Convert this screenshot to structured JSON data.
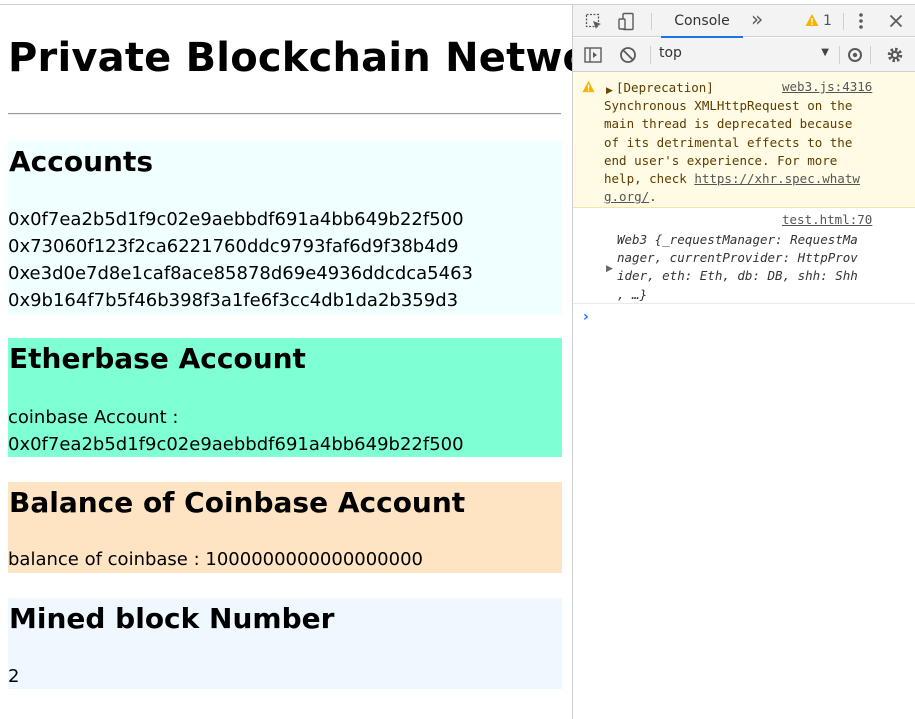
{
  "page": {
    "title": "Private Blockchain Network",
    "accounts": {
      "heading": "Accounts",
      "list": [
        "0x0f7ea2b5d1f9c02e9aebbdf691a4bb649b22f500",
        "0x73060f123f2ca6221760ddc9793faf6d9f38b4d9",
        "0xe3d0e7d8e1caf8ace85878d69e4936ddcdca5463",
        "0x9b164f7b5f46b398f3a1fe6f3cc4db1da2b359d3"
      ]
    },
    "etherbase": {
      "heading": "Etherbase Account",
      "label": "coinbase Account :",
      "value": "0x0f7ea2b5d1f9c02e9aebbdf691a4bb649b22f500"
    },
    "balance": {
      "heading": "Balance of Coinbase Account",
      "text": "balance of coinbase : 1000000000000000000"
    },
    "mined": {
      "heading": "Mined block Number",
      "value": "2"
    }
  },
  "devtools": {
    "tabs": {
      "console_label": "Console",
      "more_tabs": "»",
      "warning_count": "1"
    },
    "toolbar": {
      "context": "top"
    },
    "messages": {
      "warning": {
        "source": "web3.js:4316",
        "lines": [
          "[Deprecation]",
          "Synchronous XMLHttpRequest on the",
          "main thread is deprecated because",
          "of its detrimental effects to the",
          "end user's experience. For more",
          "help, check "
        ],
        "url_part1": "https://xhr.spec.whatw",
        "url_part2": "g.org/",
        "tail": "."
      },
      "log": {
        "source": "test.html:70",
        "lines": [
          "Web3 {_requestManager: RequestMa",
          "nager, currentProvider: HttpProv",
          "ider, eth: Eth, db: DB, shh: Shh",
          ", …}"
        ]
      }
    },
    "colors": {
      "accent": "#1a73e8",
      "warning_bg": "#fffbe5",
      "warning_icon": "#f4b400"
    },
    "icons": [
      "inspect-icon",
      "device-toggle-icon",
      "warning-icon",
      "kebab-menu-icon",
      "close-icon",
      "sidebar-toggle-icon",
      "clear-console-icon",
      "live-expression-icon",
      "settings-icon",
      "expand-triangle-icon",
      "prompt-chevron-icon"
    ]
  }
}
